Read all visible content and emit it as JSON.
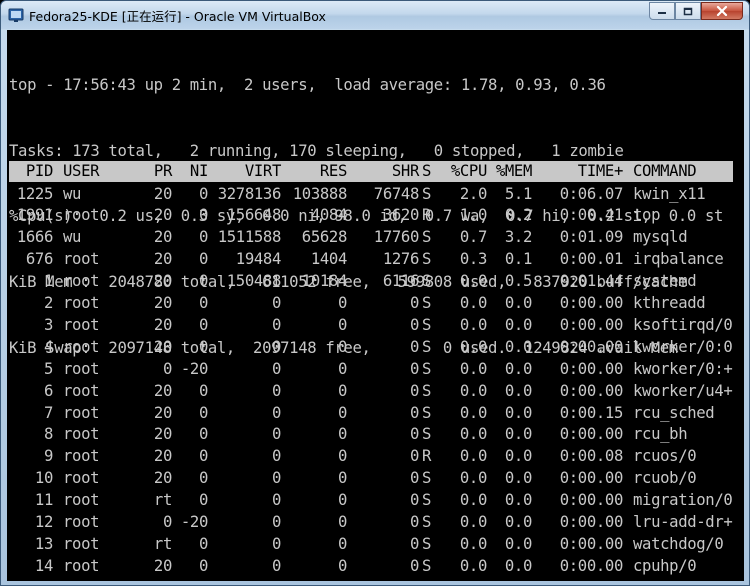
{
  "window": {
    "title": "Fedora25-KDE [正在运行] - Oracle VM VirtualBox",
    "app_icon": "virtualbox-icon",
    "controls": {
      "minimize": "minimize-icon",
      "maximize": "maximize-icon",
      "close": "close-icon"
    }
  },
  "terminal": {
    "summary": [
      "top - 17:56:43 up 2 min,  2 users,  load average: 1.78, 0.93, 0.36",
      "Tasks: 173 total,   2 running, 170 sleeping,   0 stopped,   1 zombie",
      "%Cpu(s):  0.2 us,  0.3 sy,  0.0 ni, 98.0 id,  0.7 wa,  0.7 hi,  0.2 si,  0.0 st",
      "KiB Mem :  2048780 total,   611052 free,   599808 used,   837920 buff/cache",
      "KiB Swap:  2097148 total,  2097148 free,        0 used.  1249824 avail Mem"
    ],
    "columns": [
      "PID",
      "USER",
      "PR",
      "NI",
      "VIRT",
      "RES",
      "SHR",
      "S",
      "%CPU",
      "%MEM",
      "TIME+",
      "COMMAND"
    ],
    "processes": [
      [
        "1225",
        "wu",
        "20",
        "0",
        "3278136",
        "103888",
        "76748",
        "S",
        "2.0",
        "5.1",
        "0:06.07",
        "kwin_x11"
      ],
      [
        "1991",
        "root",
        "20",
        "0",
        "156648",
        "4084",
        "3620",
        "R",
        "1.0",
        "0.2",
        "0:00.41",
        "top"
      ],
      [
        "1666",
        "wu",
        "20",
        "0",
        "1511588",
        "65628",
        "17760",
        "S",
        "0.7",
        "3.2",
        "0:01.09",
        "mysqld"
      ],
      [
        "676",
        "root",
        "20",
        "0",
        "19484",
        "1404",
        "1276",
        "S",
        "0.3",
        "0.1",
        "0:00.01",
        "irqbalance"
      ],
      [
        "1",
        "root",
        "20",
        "0",
        "150488",
        "10184",
        "6116",
        "S",
        "0.0",
        "0.5",
        "0:01.44",
        "systemd"
      ],
      [
        "2",
        "root",
        "20",
        "0",
        "0",
        "0",
        "0",
        "S",
        "0.0",
        "0.0",
        "0:00.00",
        "kthreadd"
      ],
      [
        "3",
        "root",
        "20",
        "0",
        "0",
        "0",
        "0",
        "S",
        "0.0",
        "0.0",
        "0:00.00",
        "ksoftirqd/0"
      ],
      [
        "4",
        "root",
        "20",
        "0",
        "0",
        "0",
        "0",
        "S",
        "0.0",
        "0.0",
        "0:00.00",
        "kworker/0:0"
      ],
      [
        "5",
        "root",
        "0",
        "-20",
        "0",
        "0",
        "0",
        "S",
        "0.0",
        "0.0",
        "0:00.00",
        "kworker/0:+"
      ],
      [
        "6",
        "root",
        "20",
        "0",
        "0",
        "0",
        "0",
        "S",
        "0.0",
        "0.0",
        "0:00.00",
        "kworker/u4+"
      ],
      [
        "7",
        "root",
        "20",
        "0",
        "0",
        "0",
        "0",
        "S",
        "0.0",
        "0.0",
        "0:00.15",
        "rcu_sched"
      ],
      [
        "8",
        "root",
        "20",
        "0",
        "0",
        "0",
        "0",
        "S",
        "0.0",
        "0.0",
        "0:00.00",
        "rcu_bh"
      ],
      [
        "9",
        "root",
        "20",
        "0",
        "0",
        "0",
        "0",
        "R",
        "0.0",
        "0.0",
        "0:00.08",
        "rcuos/0"
      ],
      [
        "10",
        "root",
        "20",
        "0",
        "0",
        "0",
        "0",
        "S",
        "0.0",
        "0.0",
        "0:00.00",
        "rcuob/0"
      ],
      [
        "11",
        "root",
        "rt",
        "0",
        "0",
        "0",
        "0",
        "S",
        "0.0",
        "0.0",
        "0:00.00",
        "migration/0"
      ],
      [
        "12",
        "root",
        "0",
        "-20",
        "0",
        "0",
        "0",
        "S",
        "0.0",
        "0.0",
        "0:00.00",
        "lru-add-dr+"
      ],
      [
        "13",
        "root",
        "rt",
        "0",
        "0",
        "0",
        "0",
        "S",
        "0.0",
        "0.0",
        "0:00.00",
        "watchdog/0"
      ],
      [
        "14",
        "root",
        "20",
        "0",
        "0",
        "0",
        "0",
        "S",
        "0.0",
        "0.0",
        "0:00.00",
        "cpuhp/0"
      ]
    ]
  }
}
